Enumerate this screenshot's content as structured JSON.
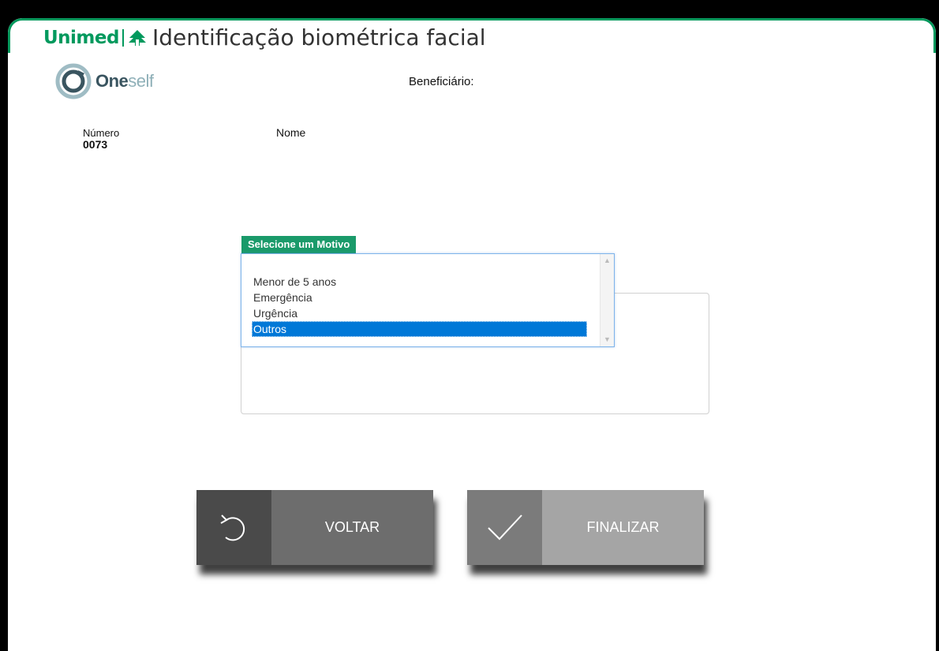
{
  "header": {
    "brand": "Unimed",
    "title": "Identificação biométrica facial"
  },
  "oneself": {
    "part1": "One",
    "part2": "self"
  },
  "beneficiario": {
    "label": "Beneficiário:",
    "numero_label": "Número",
    "numero_value": "0073",
    "nome_label": "Nome"
  },
  "motivo": {
    "legend": "Selecione um Motivo",
    "options": [
      "Menor de 5 anos",
      "Emergência",
      "Urgência",
      "Outros"
    ],
    "selected": "Outros"
  },
  "buttons": {
    "voltar": "VOLTAR",
    "finalizar": "FINALIZAR"
  },
  "colors": {
    "brand_green": "#00995d",
    "legend_green": "#1a9a6a",
    "selection_blue": "#0078d7"
  }
}
